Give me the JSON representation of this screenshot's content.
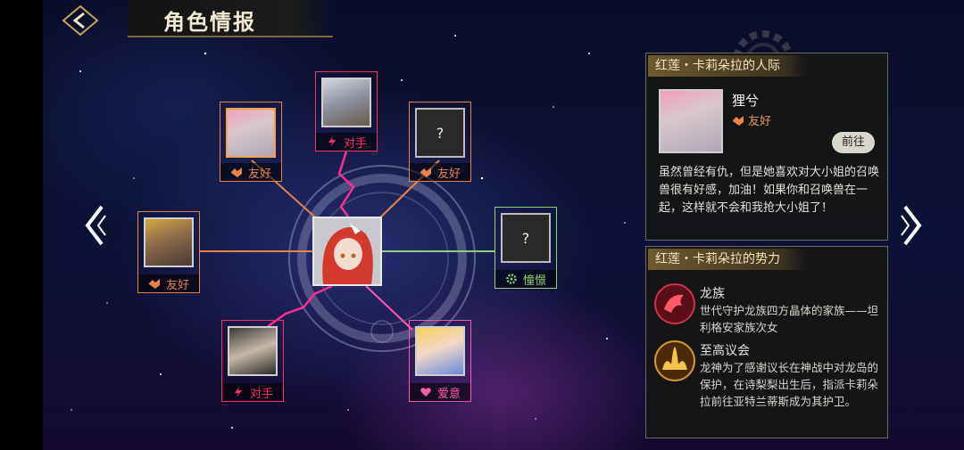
{
  "header": {
    "title": "角色情报"
  },
  "graph": {
    "nodes": [
      {
        "id": "top_left",
        "relation": "友好",
        "unknown": false
      },
      {
        "id": "top_center",
        "relation": "对手",
        "unknown": false
      },
      {
        "id": "top_right",
        "relation": "友好",
        "unknown": true,
        "mark": "?"
      },
      {
        "id": "left",
        "relation": "友好",
        "unknown": false
      },
      {
        "id": "right",
        "relation": "憧憬",
        "unknown": true,
        "mark": "?"
      },
      {
        "id": "bottom_left",
        "relation": "对手",
        "unknown": false
      },
      {
        "id": "bottom_right",
        "relation": "爱意",
        "unknown": false
      }
    ]
  },
  "relations_panel": {
    "title": "红莲・卡莉朵拉的人际",
    "name": "狸兮",
    "relation": "友好",
    "goto_label": "前往",
    "description": "虽然曾经有仇，但是她喜欢对大小姐的召唤兽很有好感，加油！如果你和召唤兽在一起，这样就不会和我抢大小姐了！"
  },
  "factions_panel": {
    "title": "红莲・卡莉朵拉的势力",
    "items": [
      {
        "name": "龙族",
        "description": "世代守护龙族四方晶体的家族——坦利格安家族次女"
      },
      {
        "name": "至高议会",
        "description": "龙神为了感谢议长在神战中对龙岛的保护，在诗梨梨出生后，指派卡莉朵拉前往亚特兰蒂斯成为其护卫。"
      }
    ]
  },
  "colors": {
    "friendly": "#e8834a",
    "rival": "#ff2e5e",
    "admire": "#8fd17a",
    "love": "#ff5aa8",
    "gold": "#c9a45a"
  }
}
